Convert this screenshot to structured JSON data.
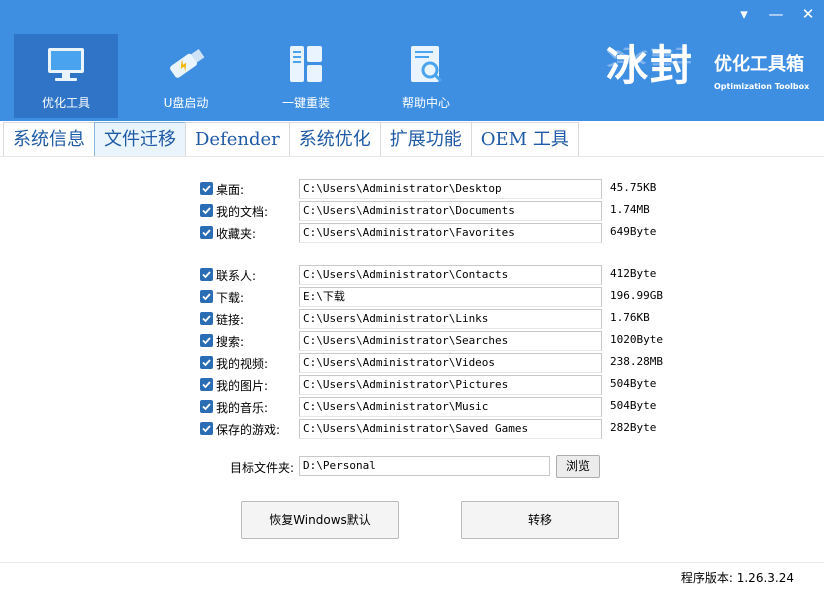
{
  "window_controls": {
    "menu": "▾",
    "minimize": "—",
    "close": "✕"
  },
  "nav": [
    {
      "label": "优化工具",
      "icon": "monitor-icon",
      "active": true
    },
    {
      "label": "U盘启动",
      "icon": "usb-drive-icon",
      "active": false
    },
    {
      "label": "一键重装",
      "icon": "windows-blocks-icon",
      "active": false
    },
    {
      "label": "帮助中心",
      "icon": "search-document-icon",
      "active": false
    }
  ],
  "brand": {
    "logo_text": "冰封",
    "title": "优化工具箱",
    "subtitle": "Optimization Toolbox"
  },
  "tabs": [
    "系统信息",
    "文件迁移",
    "Defender",
    "系统优化",
    "扩展功能",
    "OEM 工具"
  ],
  "active_tab": 1,
  "rows": [
    {
      "label": "桌面:",
      "path": "C:\\Users\\Administrator\\Desktop",
      "size": "45.75KB",
      "checked": true
    },
    {
      "label": "我的文档:",
      "path": "C:\\Users\\Administrator\\Documents",
      "size": "1.74MB",
      "checked": true
    },
    {
      "label": "收藏夹:",
      "path": "C:\\Users\\Administrator\\Favorites",
      "size": "649Byte",
      "checked": true
    },
    {
      "label": "联系人:",
      "path": "C:\\Users\\Administrator\\Contacts",
      "size": "412Byte",
      "checked": true
    },
    {
      "label": "下载:",
      "path": "E:\\下载",
      "size": "196.99GB",
      "checked": true
    },
    {
      "label": "链接:",
      "path": "C:\\Users\\Administrator\\Links",
      "size": "1.76KB",
      "checked": true
    },
    {
      "label": "搜索:",
      "path": "C:\\Users\\Administrator\\Searches",
      "size": "1020Byte",
      "checked": true
    },
    {
      "label": "我的视频:",
      "path": "C:\\Users\\Administrator\\Videos",
      "size": "238.28MB",
      "checked": true
    },
    {
      "label": "我的图片:",
      "path": "C:\\Users\\Administrator\\Pictures",
      "size": "504Byte",
      "checked": true
    },
    {
      "label": "我的音乐:",
      "path": "C:\\Users\\Administrator\\Music",
      "size": "504Byte",
      "checked": true
    },
    {
      "label": "保存的游戏:",
      "path": "C:\\Users\\Administrator\\Saved Games",
      "size": "282Byte",
      "checked": true
    }
  ],
  "target": {
    "label": "目标文件夹:",
    "value": "D:\\Personal",
    "browse": "浏览"
  },
  "buttons": {
    "restore": "恢复Windows默认",
    "migrate": "转移"
  },
  "footer": {
    "version": "程序版本: 1.26.3.24"
  },
  "colors": {
    "header": "#3e8ee2",
    "active_nav": "#2f74c6",
    "tab_text": "#1f5aa6",
    "checkbox": "#2a6db5"
  }
}
